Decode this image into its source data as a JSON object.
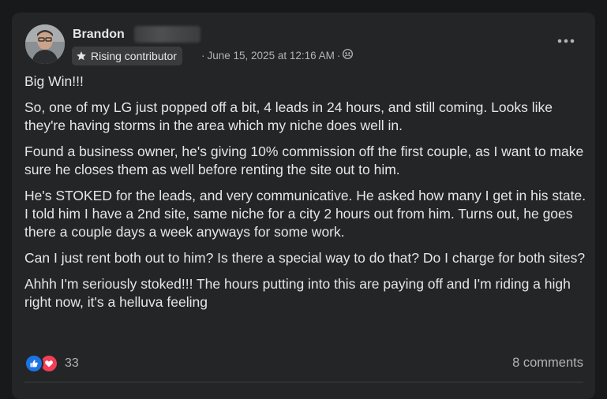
{
  "post": {
    "author": {
      "name": "Brandon",
      "badge": "Rising contributor"
    },
    "meta": {
      "separator": "·",
      "date": "June 15, 2025 at 12:16 AM",
      "audience_icon": "group-audience-icon"
    },
    "menu_icon": "more-options-icon",
    "paragraphs": [
      "Big Win!!!",
      "So, one of my LG just popped off a bit, 4 leads in 24 hours, and still coming. Looks like they're having storms in the area which my niche does well in.",
      "Found a business owner, he's giving 10% commission off the first couple, as I want to make sure he closes them as well before renting the site out to him.",
      "He's STOKED for the leads, and very communicative. He asked how many I get in his state. I told him I have a 2nd site, same niche for a city 2 hours out from him. Turns out, he goes there a couple days a week anyways for some work.",
      "Can I just rent both out to him? Is there a special way to do that? Do I charge for both sites?",
      "Ahhh I'm seriously stoked!!! The hours putting into this are paying off and I'm riding a high right now, it's a helluva feeling"
    ],
    "reactions": {
      "types": [
        "like",
        "love"
      ],
      "count": "33"
    },
    "comments_label": "8 comments"
  },
  "colors": {
    "background": "#18191a",
    "card": "#242526",
    "primary_text": "#e4e6eb",
    "secondary_text": "#b0b3b8",
    "like_blue": "#1b74e4",
    "love_red": "#f33e58"
  }
}
